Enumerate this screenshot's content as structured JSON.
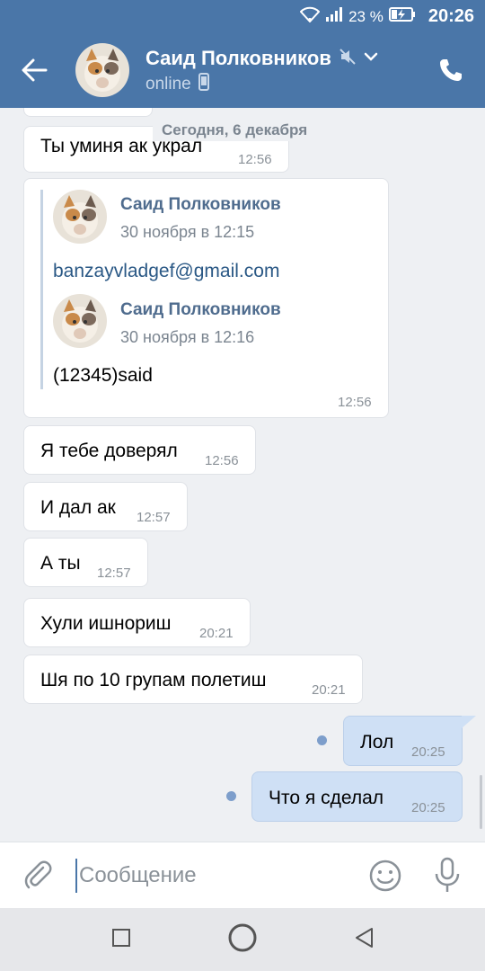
{
  "status_bar": {
    "battery": "23 %",
    "time": "20:26"
  },
  "header": {
    "name": "Саид Полковников",
    "status": "online"
  },
  "chat": {
    "date_separator": "Сегодня, 6 декабря",
    "partial_message": {
      "text": "Ты уминя ак украл",
      "time": "12:56"
    },
    "forwarded_message": {
      "time": "12:56",
      "items": [
        {
          "author": "Саид Полковников",
          "date": "30 ноября в 12:15",
          "text": "banzayvladgef@gmail.com"
        },
        {
          "author": "Саид Полковников",
          "date": "30 ноября в 12:16",
          "text": "(12345)said"
        }
      ]
    },
    "messages": [
      {
        "text": "Я тебе доверял",
        "time": "12:56",
        "direction": "in"
      },
      {
        "text": "И дал ак",
        "time": "12:57",
        "direction": "in"
      },
      {
        "text": "А ты",
        "time": "12:57",
        "direction": "in"
      },
      {
        "text": "Хули ишнориш",
        "time": "20:21",
        "direction": "in"
      },
      {
        "text": "Шя по 10 групам полетиш",
        "time": "20:21",
        "direction": "in"
      },
      {
        "text": "Лол",
        "time": "20:25",
        "direction": "out",
        "unread": true
      },
      {
        "text": "Что я сделал",
        "time": "20:25",
        "direction": "out",
        "unread": true
      }
    ]
  },
  "input": {
    "placeholder": "Сообщение"
  },
  "colors": {
    "accent": "#4a76a8",
    "outgoing_bubble": "#cfe0f5",
    "background": "#eef0f3",
    "link": "#2a5885"
  },
  "icons": {
    "back": "arrow-left-icon",
    "mute": "muted-speaker-icon",
    "dropdown": "chevron-down-icon",
    "call": "phone-icon",
    "attach": "paperclip-icon",
    "emoji": "smiley-icon",
    "mic": "microphone-icon"
  }
}
